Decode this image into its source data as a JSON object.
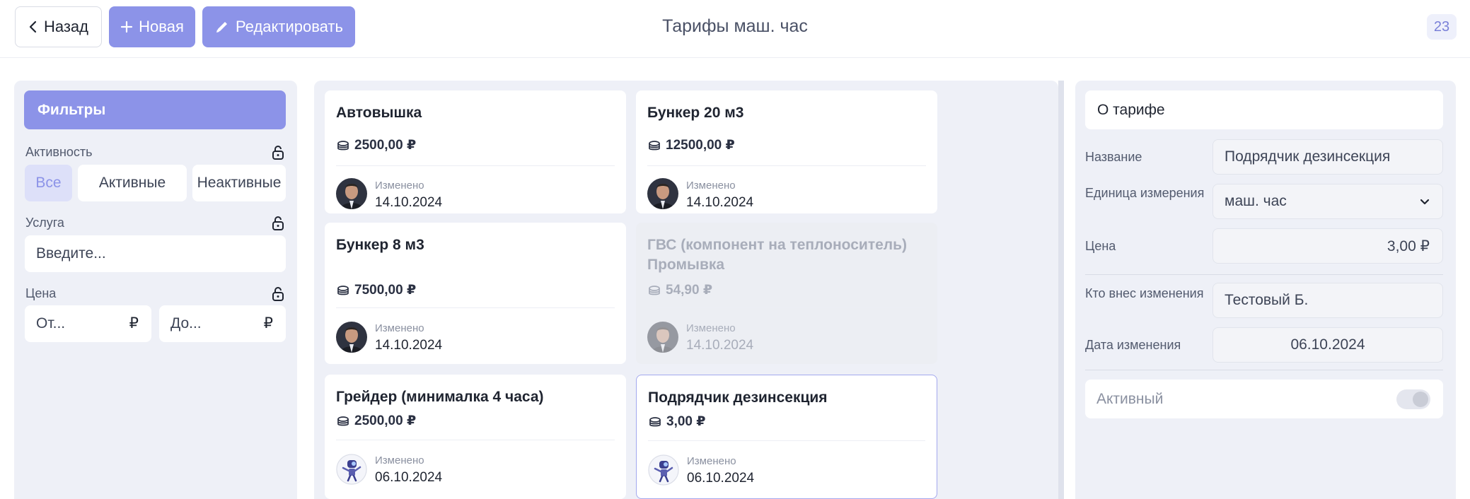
{
  "toolbar": {
    "back_label": "Назад",
    "new_label": "Новая",
    "edit_label": "Редактировать",
    "title": "Тарифы маш. час",
    "counter": "23"
  },
  "filters": {
    "header": "Фильтры",
    "activity_label": "Активность",
    "activity_options": [
      "Все",
      "Активные",
      "Неактивные"
    ],
    "activity_selected": "Все",
    "service_label": "Услуга",
    "service_placeholder": "Введите...",
    "price_label": "Цена",
    "price_from_placeholder": "От...",
    "price_to_placeholder": "До...",
    "currency": "₽"
  },
  "cards": [
    {
      "name": "Автовышка",
      "price": "2500,00 ₽",
      "changed_label": "Изменено",
      "date": "14.10.2024",
      "active": true,
      "selected": false,
      "avatar": "photo"
    },
    {
      "name": "Бункер 20 м3",
      "price": "12500,00 ₽",
      "changed_label": "Изменено",
      "date": "14.10.2024",
      "active": true,
      "selected": false,
      "avatar": "photo"
    },
    {
      "name": "Бункер 8 м3",
      "price": "7500,00 ₽",
      "changed_label": "Изменено",
      "date": "14.10.2024",
      "active": true,
      "selected": false,
      "avatar": "photo"
    },
    {
      "name": "ГВС (компонент на теплоноситель) Промывка",
      "price": "54,90 ₽",
      "changed_label": "Изменено",
      "date": "14.10.2024",
      "active": false,
      "selected": false,
      "avatar": "photo"
    },
    {
      "name": "Грейдер (минималка 4 часа)",
      "price": "2500,00 ₽",
      "changed_label": "Изменено",
      "date": "06.10.2024",
      "active": true,
      "selected": false,
      "avatar": "robot"
    },
    {
      "name": "Подрядчик дезинсекция",
      "price": "3,00 ₽",
      "changed_label": "Изменено",
      "date": "06.10.2024",
      "active": true,
      "selected": true,
      "avatar": "robot"
    }
  ],
  "details": {
    "header": "О тарифе",
    "name_label": "Название",
    "name_value": "Подрядчик дезинсекция",
    "unit_label": "Единица измерения",
    "unit_value": "маш. час",
    "price_label": "Цена",
    "price_value": "3,00 ₽",
    "author_label": "Кто внес изменения",
    "author_value": "Тестовый Б.",
    "date_label": "Дата изменения",
    "date_value": "06.10.2024",
    "active_label": "Активный",
    "active_on": false
  },
  "colors": {
    "accent": "#8c93e8",
    "panel_bg": "#eef0f7"
  }
}
